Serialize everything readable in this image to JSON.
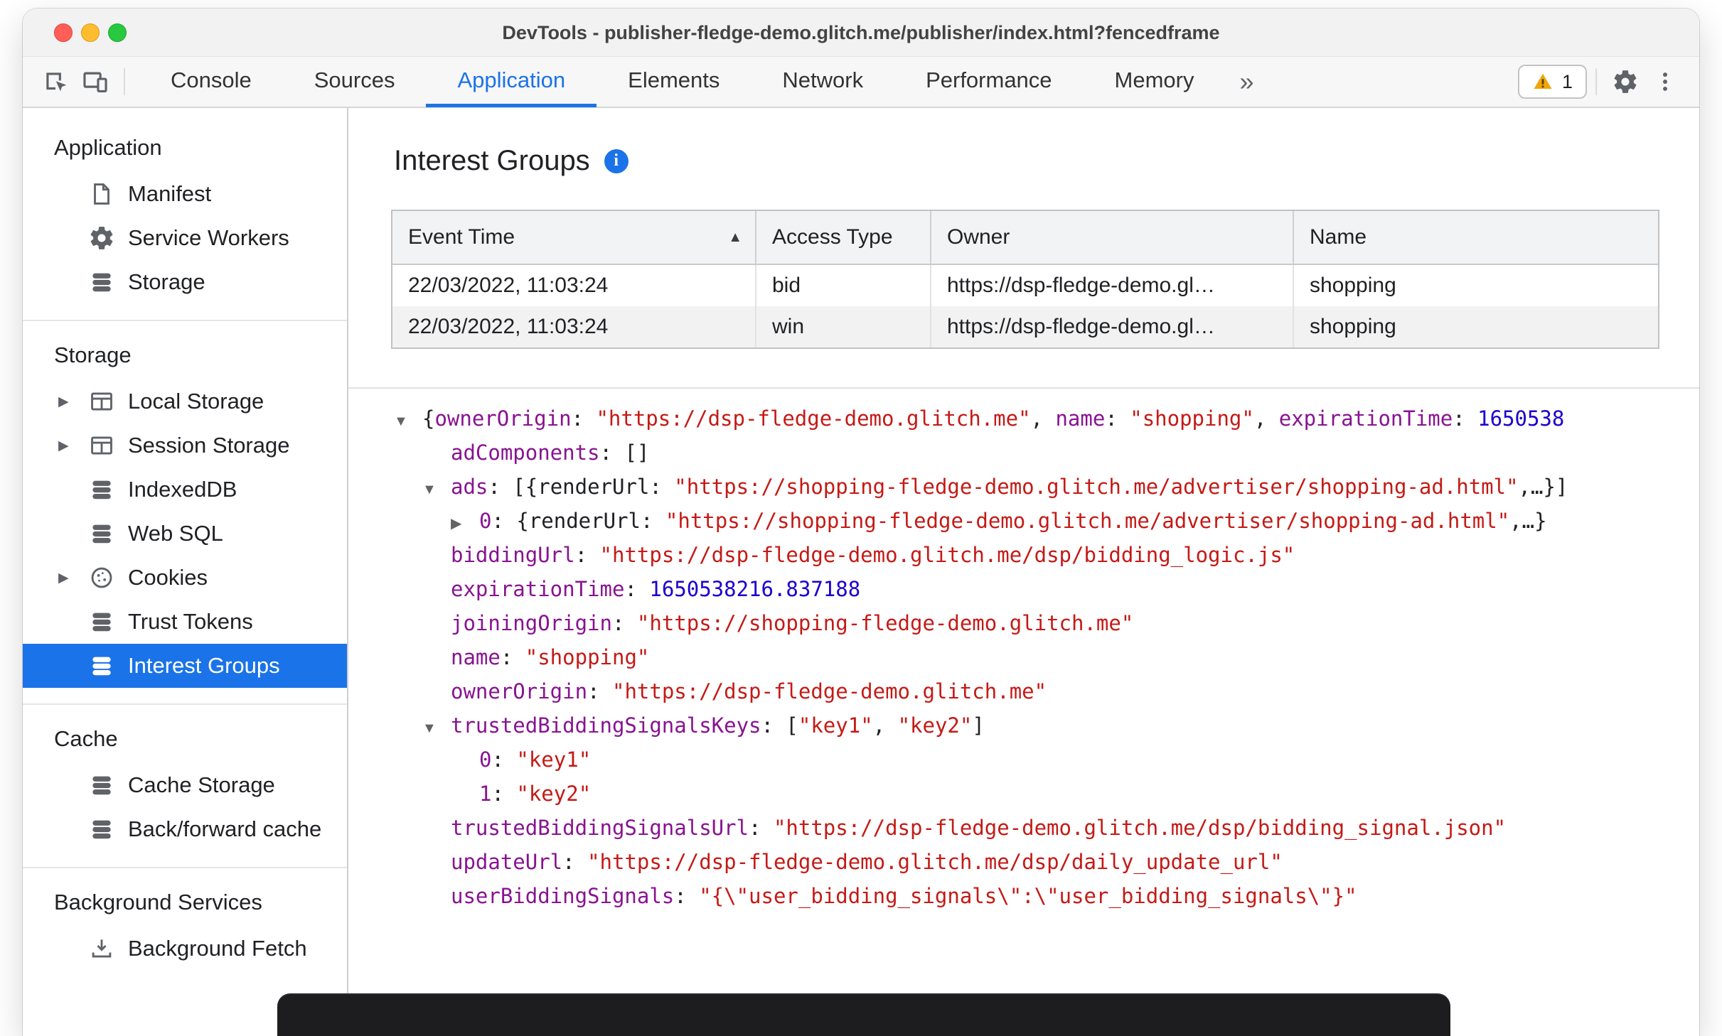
{
  "window": {
    "title": "DevTools - publisher-fledge-demo.glitch.me/publisher/index.html?fencedframe"
  },
  "toolbar": {
    "left_icons": [
      "inspect-icon",
      "device-toolbar-icon"
    ],
    "tabs": [
      {
        "label": "Console",
        "active": false
      },
      {
        "label": "Sources",
        "active": false
      },
      {
        "label": "Application",
        "active": true
      },
      {
        "label": "Elements",
        "active": false
      },
      {
        "label": "Network",
        "active": false
      },
      {
        "label": "Performance",
        "active": false
      },
      {
        "label": "Memory",
        "active": false
      }
    ],
    "more_tabs": "»",
    "warning_count": "1",
    "right_icons": [
      "warning-icon",
      "gear-icon",
      "more-menu-icon"
    ]
  },
  "sidebar": {
    "expander_glyph": "▶",
    "sections": [
      {
        "title": "Application",
        "items": [
          {
            "label": "Manifest",
            "icon": "manifest-icon"
          },
          {
            "label": "Service Workers",
            "icon": "gear-icon"
          },
          {
            "label": "Storage",
            "icon": "database-icon"
          }
        ]
      },
      {
        "title": "Storage",
        "items": [
          {
            "label": "Local Storage",
            "icon": "table-icon",
            "expander": true
          },
          {
            "label": "Session Storage",
            "icon": "table-icon",
            "expander": true
          },
          {
            "label": "IndexedDB",
            "icon": "database-icon"
          },
          {
            "label": "Web SQL",
            "icon": "database-icon"
          },
          {
            "label": "Cookies",
            "icon": "cookie-icon",
            "expander": true
          },
          {
            "label": "Trust Tokens",
            "icon": "database-icon"
          },
          {
            "label": "Interest Groups",
            "icon": "database-icon",
            "selected": true
          }
        ]
      },
      {
        "title": "Cache",
        "items": [
          {
            "label": "Cache Storage",
            "icon": "database-icon"
          },
          {
            "label": "Back/forward cache",
            "icon": "database-icon"
          }
        ]
      },
      {
        "title": "Background Services",
        "items": [
          {
            "label": "Background Fetch",
            "icon": "background-fetch-icon"
          }
        ]
      }
    ]
  },
  "main": {
    "title": "Interest Groups",
    "info_icon": "i",
    "table": {
      "columns": [
        "Event Time",
        "Access Type",
        "Owner",
        "Name"
      ],
      "sorted_column": "Event Time",
      "sort_icon": "▲",
      "rows": [
        [
          "22/03/2022, 11:03:24",
          "bid",
          "https://dsp-fledge-demo.gl…",
          "shopping"
        ],
        [
          "22/03/2022, 11:03:24",
          "win",
          "https://dsp-fledge-demo.gl…",
          "shopping"
        ]
      ]
    },
    "tree": {
      "lines": [
        {
          "indent": 0,
          "marker": "▼",
          "segments": [
            {
              "t": "p",
              "x": "{"
            },
            {
              "t": "k",
              "x": "ownerOrigin"
            },
            {
              "t": "p",
              "x": ": "
            },
            {
              "t": "s",
              "x": "\"https://dsp-fledge-demo.glitch.me\""
            },
            {
              "t": "p",
              "x": ", "
            },
            {
              "t": "k",
              "x": "name"
            },
            {
              "t": "p",
              "x": ": "
            },
            {
              "t": "s",
              "x": "\"shopping\""
            },
            {
              "t": "p",
              "x": ", "
            },
            {
              "t": "k",
              "x": "expirationTime"
            },
            {
              "t": "p",
              "x": ": "
            },
            {
              "t": "n",
              "x": "1650538"
            }
          ]
        },
        {
          "indent": 1,
          "marker": "",
          "segments": [
            {
              "t": "k",
              "x": "adComponents"
            },
            {
              "t": "p",
              "x": ": "
            },
            {
              "t": "p",
              "x": "[]"
            }
          ]
        },
        {
          "indent": 1,
          "marker": "▼",
          "segments": [
            {
              "t": "k",
              "x": "ads"
            },
            {
              "t": "p",
              "x": ": "
            },
            {
              "t": "p",
              "x": "[{renderUrl: "
            },
            {
              "t": "s",
              "x": "\"https://shopping-fledge-demo.glitch.me/advertiser/shopping-ad.html\""
            },
            {
              "t": "p",
              "x": ",…}]"
            }
          ]
        },
        {
          "indent": 2,
          "marker": "▶",
          "segments": [
            {
              "t": "k",
              "x": "0"
            },
            {
              "t": "p",
              "x": ": {renderUrl: "
            },
            {
              "t": "s",
              "x": "\"https://shopping-fledge-demo.glitch.me/advertiser/shopping-ad.html\""
            },
            {
              "t": "p",
              "x": ",…}"
            }
          ]
        },
        {
          "indent": 1,
          "marker": "",
          "segments": [
            {
              "t": "k",
              "x": "biddingUrl"
            },
            {
              "t": "p",
              "x": ": "
            },
            {
              "t": "s",
              "x": "\"https://dsp-fledge-demo.glitch.me/dsp/bidding_logic.js\""
            }
          ]
        },
        {
          "indent": 1,
          "marker": "",
          "segments": [
            {
              "t": "k",
              "x": "expirationTime"
            },
            {
              "t": "p",
              "x": ": "
            },
            {
              "t": "n",
              "x": "1650538216.837188"
            }
          ]
        },
        {
          "indent": 1,
          "marker": "",
          "segments": [
            {
              "t": "k",
              "x": "joiningOrigin"
            },
            {
              "t": "p",
              "x": ": "
            },
            {
              "t": "s",
              "x": "\"https://shopping-fledge-demo.glitch.me\""
            }
          ]
        },
        {
          "indent": 1,
          "marker": "",
          "segments": [
            {
              "t": "k",
              "x": "name"
            },
            {
              "t": "p",
              "x": ": "
            },
            {
              "t": "s",
              "x": "\"shopping\""
            }
          ]
        },
        {
          "indent": 1,
          "marker": "",
          "segments": [
            {
              "t": "k",
              "x": "ownerOrigin"
            },
            {
              "t": "p",
              "x": ": "
            },
            {
              "t": "s",
              "x": "\"https://dsp-fledge-demo.glitch.me\""
            }
          ]
        },
        {
          "indent": 1,
          "marker": "▼",
          "segments": [
            {
              "t": "k",
              "x": "trustedBiddingSignalsKeys"
            },
            {
              "t": "p",
              "x": ": "
            },
            {
              "t": "p",
              "x": "["
            },
            {
              "t": "s",
              "x": "\"key1\""
            },
            {
              "t": "p",
              "x": ", "
            },
            {
              "t": "s",
              "x": "\"key2\""
            },
            {
              "t": "p",
              "x": "]"
            }
          ]
        },
        {
          "indent": 2,
          "marker": "",
          "segments": [
            {
              "t": "k",
              "x": "0"
            },
            {
              "t": "p",
              "x": ": "
            },
            {
              "t": "s",
              "x": "\"key1\""
            }
          ]
        },
        {
          "indent": 2,
          "marker": "",
          "segments": [
            {
              "t": "k",
              "x": "1"
            },
            {
              "t": "p",
              "x": ": "
            },
            {
              "t": "s",
              "x": "\"key2\""
            }
          ]
        },
        {
          "indent": 1,
          "marker": "",
          "segments": [
            {
              "t": "k",
              "x": "trustedBiddingSignalsUrl"
            },
            {
              "t": "p",
              "x": ": "
            },
            {
              "t": "s",
              "x": "\"https://dsp-fledge-demo.glitch.me/dsp/bidding_signal.json\""
            }
          ]
        },
        {
          "indent": 1,
          "marker": "",
          "segments": [
            {
              "t": "k",
              "x": "updateUrl"
            },
            {
              "t": "p",
              "x": ": "
            },
            {
              "t": "s",
              "x": "\"https://dsp-fledge-demo.glitch.me/dsp/daily_update_url\""
            }
          ]
        },
        {
          "indent": 1,
          "marker": "",
          "segments": [
            {
              "t": "k",
              "x": "userBiddingSignals"
            },
            {
              "t": "p",
              "x": ": "
            },
            {
              "t": "s",
              "x": "\"{\\\"user_bidding_signals\\\":\\\"user_bidding_signals\\\"}\""
            }
          ]
        }
      ]
    }
  },
  "colors": {
    "accent_blue": "#1a73e8",
    "tree_key": "#881391",
    "tree_string": "#c41a16",
    "tree_number": "#1c00cf",
    "warning_yellow": "#f0a607",
    "selected_row_bg": "#1a73e8"
  }
}
